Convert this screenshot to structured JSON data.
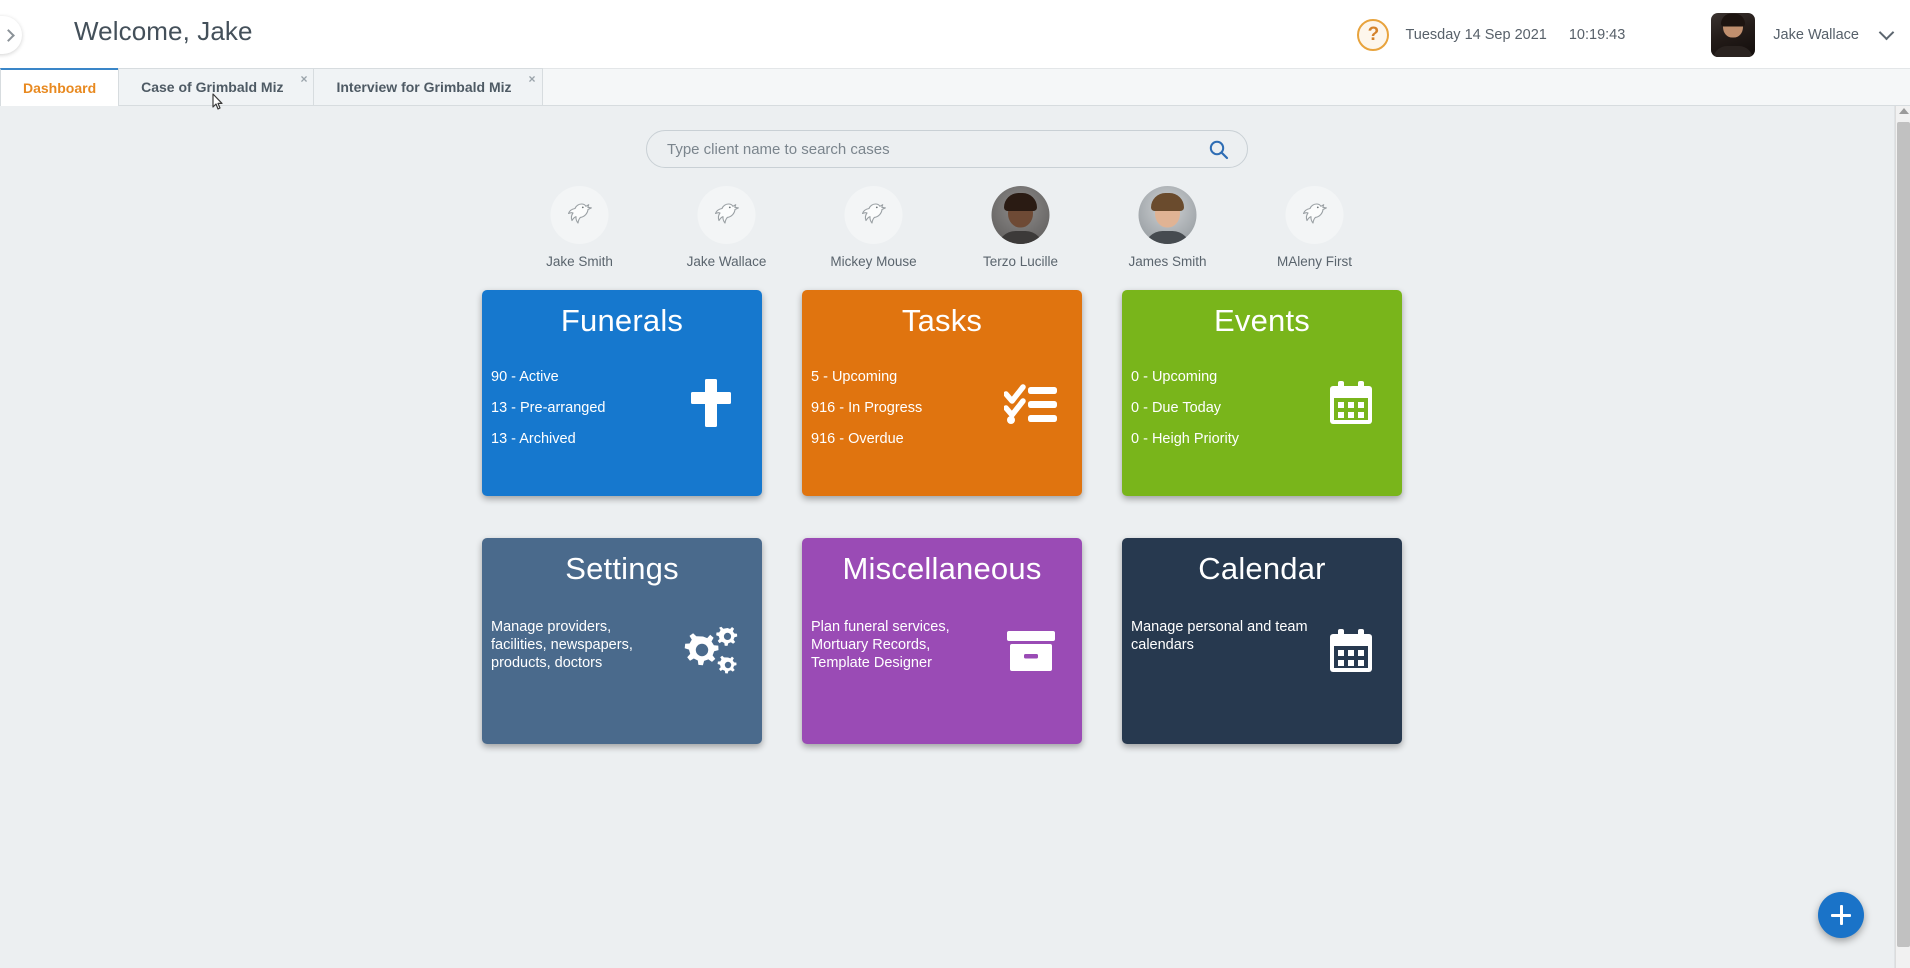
{
  "header": {
    "sidebar_toggle_icon": "chevron-right-icon",
    "welcome_title": "Welcome, Jake",
    "help_icon": "question-mark-icon",
    "date": "Tuesday 14 Sep 2021",
    "time": "10:19:43",
    "user_name": "Jake Wallace",
    "user_menu_icon": "chevron-down-icon",
    "avatar_alt": "Jake Wallace avatar"
  },
  "tabs": [
    {
      "label": "Dashboard",
      "active": true,
      "closable": false
    },
    {
      "label": "Case of Grimbald Miz",
      "active": false,
      "closable": true,
      "close_label": "×"
    },
    {
      "label": "Interview for Grimbald Miz",
      "active": false,
      "closable": true,
      "close_label": "×"
    }
  ],
  "search": {
    "placeholder": "Type client name to search cases",
    "value": "",
    "icon": "search-icon"
  },
  "clients": [
    {
      "name": "Jake Smith",
      "avatar": "dove-placeholder"
    },
    {
      "name": "Jake Wallace",
      "avatar": "dove-placeholder"
    },
    {
      "name": "Mickey Mouse",
      "avatar": "dove-placeholder"
    },
    {
      "name": "Terzo Lucille",
      "avatar": "photo-female"
    },
    {
      "name": "James Smith",
      "avatar": "photo-male"
    },
    {
      "name": "MAleny First",
      "avatar": "dove-placeholder"
    }
  ],
  "cards": [
    {
      "title": "Funerals",
      "color": "#1678ce",
      "icon": "cross-icon",
      "stats": [
        "90 - Active",
        "13 - Pre-arranged",
        "13 - Archived"
      ],
      "description": ""
    },
    {
      "title": "Tasks",
      "color": "#e0740f",
      "icon": "checklist-icon",
      "stats": [
        "5 - Upcoming",
        "916 - In Progress",
        "916 - Overdue"
      ],
      "description": ""
    },
    {
      "title": "Events",
      "color": "#79b51b",
      "icon": "calendar-icon",
      "stats": [
        "0 - Upcoming",
        "0 - Due Today",
        "0 - Heigh Priority"
      ],
      "description": ""
    },
    {
      "title": "Settings",
      "color": "#4a6a8c",
      "icon": "gears-icon",
      "stats": [],
      "description": "Manage providers, facilities, newspapers, products, doctors"
    },
    {
      "title": "Miscellaneous",
      "color": "#9a4bb5",
      "icon": "archive-box-icon",
      "stats": [],
      "description": "Plan funeral services, Mortuary Records, Template Designer"
    },
    {
      "title": "Calendar",
      "color": "#27394f",
      "icon": "calendar-icon",
      "stats": [],
      "description": "Manage personal and team calendars"
    }
  ],
  "fab": {
    "icon": "plus-icon",
    "label": "Add"
  },
  "scrollbar": {
    "up_icon": "caret-up-icon"
  },
  "colors": {
    "page_background": "#eceff1",
    "header_background": "#ffffff",
    "active_tab_text": "#e8891f",
    "active_tab_border": "#3a86c8",
    "fab": "#1a73c8",
    "search_icon": "#2e6db4",
    "help_accent": "#e8a33d"
  }
}
